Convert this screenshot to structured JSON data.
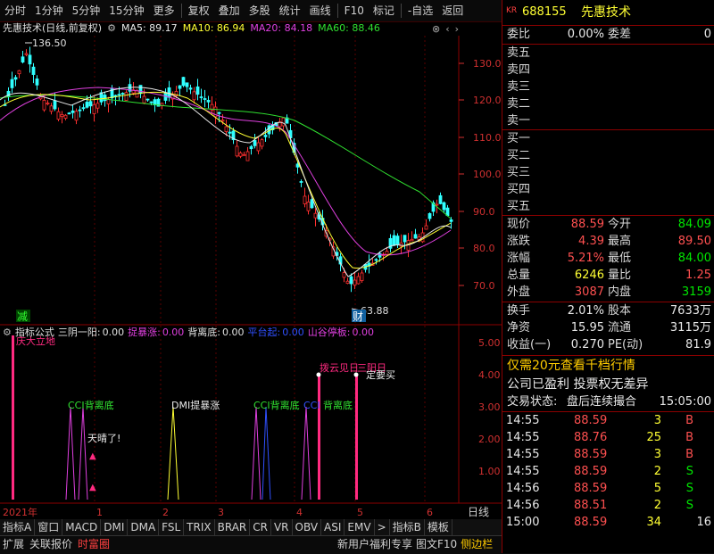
{
  "toolbar": {
    "items": [
      "分时",
      "1分钟",
      "5分钟",
      "15分钟",
      "更多",
      "复权",
      "叠加",
      "多股",
      "统计",
      "画线",
      "F10",
      "标记",
      "-自选",
      "返回"
    ]
  },
  "main_title": {
    "stock_name": "先惠技术",
    "mode": "(日线,前复权)",
    "ma5_label": "MA5: 89.17",
    "ma10_label": "MA10: 86.94",
    "ma20_label": "MA20: 84.18",
    "ma60_label": "MA60: 88.46"
  },
  "price_axis": [
    "130.0",
    "120.0",
    "110.0",
    "100.0",
    "90.0",
    "80.0",
    "70.0"
  ],
  "annotations": {
    "high_price": "136.50",
    "low_price": "63.88",
    "jian": "减",
    "cai": "财"
  },
  "indicator": {
    "header_name": "指标公式",
    "items": [
      {
        "label": "三阴一阳:",
        "value": "0.00",
        "color": "#e0e0e0"
      },
      {
        "label": "捉暴涨:",
        "value": "0.00",
        "color": "#e040e0"
      },
      {
        "label": "背离底:",
        "value": "0.00",
        "color": "#e0e0e0"
      },
      {
        "label": "平台起:",
        "value": "0.00",
        "color": "#3050ff"
      },
      {
        "label": "山谷停板:",
        "value": "0.00",
        "color": "#e040e0"
      }
    ],
    "axis": [
      "5.00",
      "4.00",
      "3.00",
      "2.00",
      "1.00"
    ],
    "signals": {
      "s0": "庆大立地",
      "s1": "CCI背离底",
      "s2": "DMI提暴涨",
      "s3": "天晴了!",
      "s4": "CCI背离底",
      "s5": "拨云见日",
      "s6": "三阳日",
      "s7": "定要买",
      "s8": "CCI",
      "s9": "背离底"
    }
  },
  "time_axis": [
    "2021年",
    "1",
    "2",
    "3",
    "4",
    "5",
    "6"
  ],
  "time_axis_right": "日线",
  "tabs": [
    "指标A",
    "窗口",
    "MACD",
    "DMI",
    "DMA",
    "FSL",
    "TRIX",
    "BRAR",
    "CR",
    "VR",
    "OBV",
    "ASI",
    "EMV",
    ">",
    "指标B",
    "模板"
  ],
  "statusbar": {
    "left": [
      "扩展",
      "关联报价",
      "时富圈"
    ],
    "right": [
      "新用户福利专享",
      "图文F10",
      "侧边栏"
    ],
    "icons": [
      "笔",
      "价",
      "细",
      "势",
      "联",
      "值",
      "主"
    ]
  },
  "quote": {
    "badge": "KR",
    "code": "688155",
    "name": "先惠技术",
    "weibi_label": "委比",
    "weibi_value": "0.00%",
    "weicha_label": "委差",
    "weicha_value": "0",
    "sell": [
      "卖五",
      "卖四",
      "卖三",
      "卖二",
      "卖一"
    ],
    "buy": [
      "买一",
      "买二",
      "买三",
      "买四",
      "买五"
    ],
    "stats": [
      {
        "l1": "现价",
        "v1": "88.59",
        "c1": "red",
        "l2": "今开",
        "v2": "84.09",
        "c2": "green"
      },
      {
        "l1": "涨跌",
        "v1": "4.39",
        "c1": "red",
        "l2": "最高",
        "v2": "89.50",
        "c2": "red"
      },
      {
        "l1": "涨幅",
        "v1": "5.21%",
        "c1": "red",
        "l2": "最低",
        "v2": "84.00",
        "c2": "green"
      },
      {
        "l1": "总量",
        "v1": "6246",
        "c1": "yellow",
        "l2": "量比",
        "v2": "1.25",
        "c2": "red"
      },
      {
        "l1": "外盘",
        "v1": "3087",
        "c1": "red",
        "l2": "内盘",
        "v2": "3159",
        "c2": "green"
      }
    ],
    "stats2": [
      {
        "l1": "换手",
        "v1": "2.01%",
        "l2": "股本",
        "v2": "7633万"
      },
      {
        "l1": "净资",
        "v1": "15.95",
        "l2": "流通",
        "v2": "3115万"
      },
      {
        "l1": "收益(一)",
        "v1": "0.270",
        "l2": "PE(动)",
        "v2": "81.9"
      }
    ],
    "promo": "仅需20元查看千档行情",
    "profit_line": "公司已盈利 投票权无差异",
    "trade_status_label": "交易状态:",
    "trade_status": "盘后连续撮合",
    "trade_time": "15:05:00",
    "ticks": [
      {
        "t": "14:55",
        "p": "88.59",
        "v": "3",
        "s": "B"
      },
      {
        "t": "14:55",
        "p": "88.76",
        "v": "25",
        "s": "B"
      },
      {
        "t": "14:55",
        "p": "88.59",
        "v": "3",
        "s": "B"
      },
      {
        "t": "14:55",
        "p": "88.59",
        "v": "2",
        "s": "S"
      },
      {
        "t": "14:56",
        "p": "88.59",
        "v": "5",
        "s": "S"
      },
      {
        "t": "14:56",
        "p": "88.51",
        "v": "2",
        "s": "S"
      },
      {
        "t": "15:00",
        "p": "88.59",
        "v": "34",
        "s": "16"
      }
    ]
  }
}
